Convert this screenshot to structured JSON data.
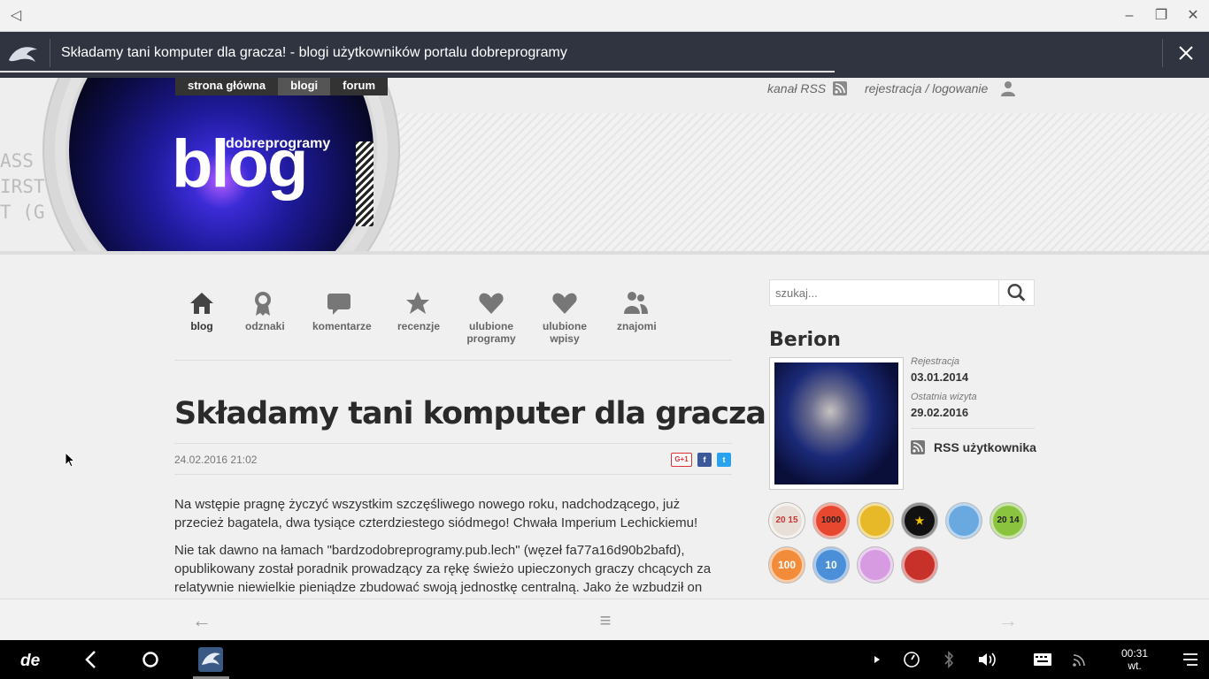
{
  "window": {
    "back_icon": "triangle-left-icon",
    "minimize": "–",
    "restore": "❐",
    "close": "✕"
  },
  "browser": {
    "tab_title": "Składamy tani komputer dla gracza! - blogi użytkowników portalu dobreprogramy",
    "load_progress": 0.69
  },
  "header": {
    "brand_small": "dobreprogramy",
    "brand_big": "blog",
    "code_lines": [
      "ASS",
      "IRST",
      "T (G"
    ],
    "nav": [
      {
        "label": "strona główna",
        "active": false
      },
      {
        "label": "blogi",
        "active": true
      },
      {
        "label": "forum",
        "active": false
      }
    ],
    "rss_label": "kanał RSS",
    "login_label": "rejestracja / logowanie"
  },
  "tabs": [
    {
      "label": "blog",
      "icon": "home-icon",
      "active": true
    },
    {
      "label": "odznaki",
      "icon": "award-icon",
      "active": false
    },
    {
      "label": "komentarze",
      "icon": "comment-icon",
      "active": false
    },
    {
      "label": "recenzje",
      "icon": "star-icon",
      "active": false
    },
    {
      "label_line1": "ulubione",
      "label_line2": "programy",
      "icon": "heart-icon",
      "active": false
    },
    {
      "label_line1": "ulubione",
      "label_line2": "wpisy",
      "icon": "heart-icon",
      "active": false
    },
    {
      "label": "znajomi",
      "icon": "friends-icon",
      "active": false
    }
  ],
  "article": {
    "title": "Składamy tani komputer dla gracza!",
    "date": "24.02.2016 21:02",
    "share": [
      "G+1",
      "f",
      "t"
    ],
    "paragraphs": [
      "Na wstępie pragnę życzyć wszystkim szczęśliwego nowego roku, nadchodzącego, już przecież bagatela, dwa tysiące czterdziestego siódmego! Chwała Imperium Lechickiemu!",
      "Nie tak dawno na łamach \"bardzodobreprogramy.pub.lech\" (węzeł fa77a16d90b2bafd), opublikowany został poradnik prowadzący za rękę świeżo upieczonych graczy chcących za relatywnie niewielkie pieniądze zbudować swoją jednostkę centralną. Jako że wzbudził on"
    ]
  },
  "sidebar": {
    "search_placeholder": "szukaj...",
    "username": "Berion",
    "registration_label": "Rejestracja",
    "registration_date": "03.01.2014",
    "last_visit_label": "Ostatnia wizyta",
    "last_visit_date": "29.02.2016",
    "rss_user": "RSS użytkownika",
    "badges": [
      {
        "label": "20 15",
        "color": "#e8e0d8",
        "text_color": "#c33"
      },
      {
        "label": "1000",
        "color": "#e8472f",
        "text_color": "#222"
      },
      {
        "label": "",
        "color": "#e7b827",
        "text_color": "#fff"
      },
      {
        "label": "★",
        "color": "#111111",
        "text_color": "#f2c200"
      },
      {
        "label": "",
        "color": "#6aa8e0",
        "text_color": "#fff"
      },
      {
        "label": "20 14",
        "color": "#8ac43f",
        "text_color": "#222"
      },
      {
        "label": "100",
        "color": "#f28c3a",
        "text_color": "#fff"
      },
      {
        "label": "10",
        "color": "#4a8fd8",
        "text_color": "#fff"
      },
      {
        "label": "",
        "color": "#d69be0",
        "text_color": "#fff"
      },
      {
        "label": "",
        "color": "#c8302a",
        "text_color": "#fff"
      }
    ]
  },
  "bottom_nav": {
    "back": "←",
    "menu": "≡",
    "forward": "→"
  },
  "taskbar": {
    "time": "00:31",
    "day": "wt.",
    "icons": [
      "de-logo-icon",
      "back-icon",
      "home-circle-icon",
      "browser-app-icon",
      "play-icon",
      "gauge-icon",
      "bluetooth-icon",
      "volume-icon",
      "keyboard-icon",
      "wifi-icon",
      "menu-icon"
    ]
  }
}
